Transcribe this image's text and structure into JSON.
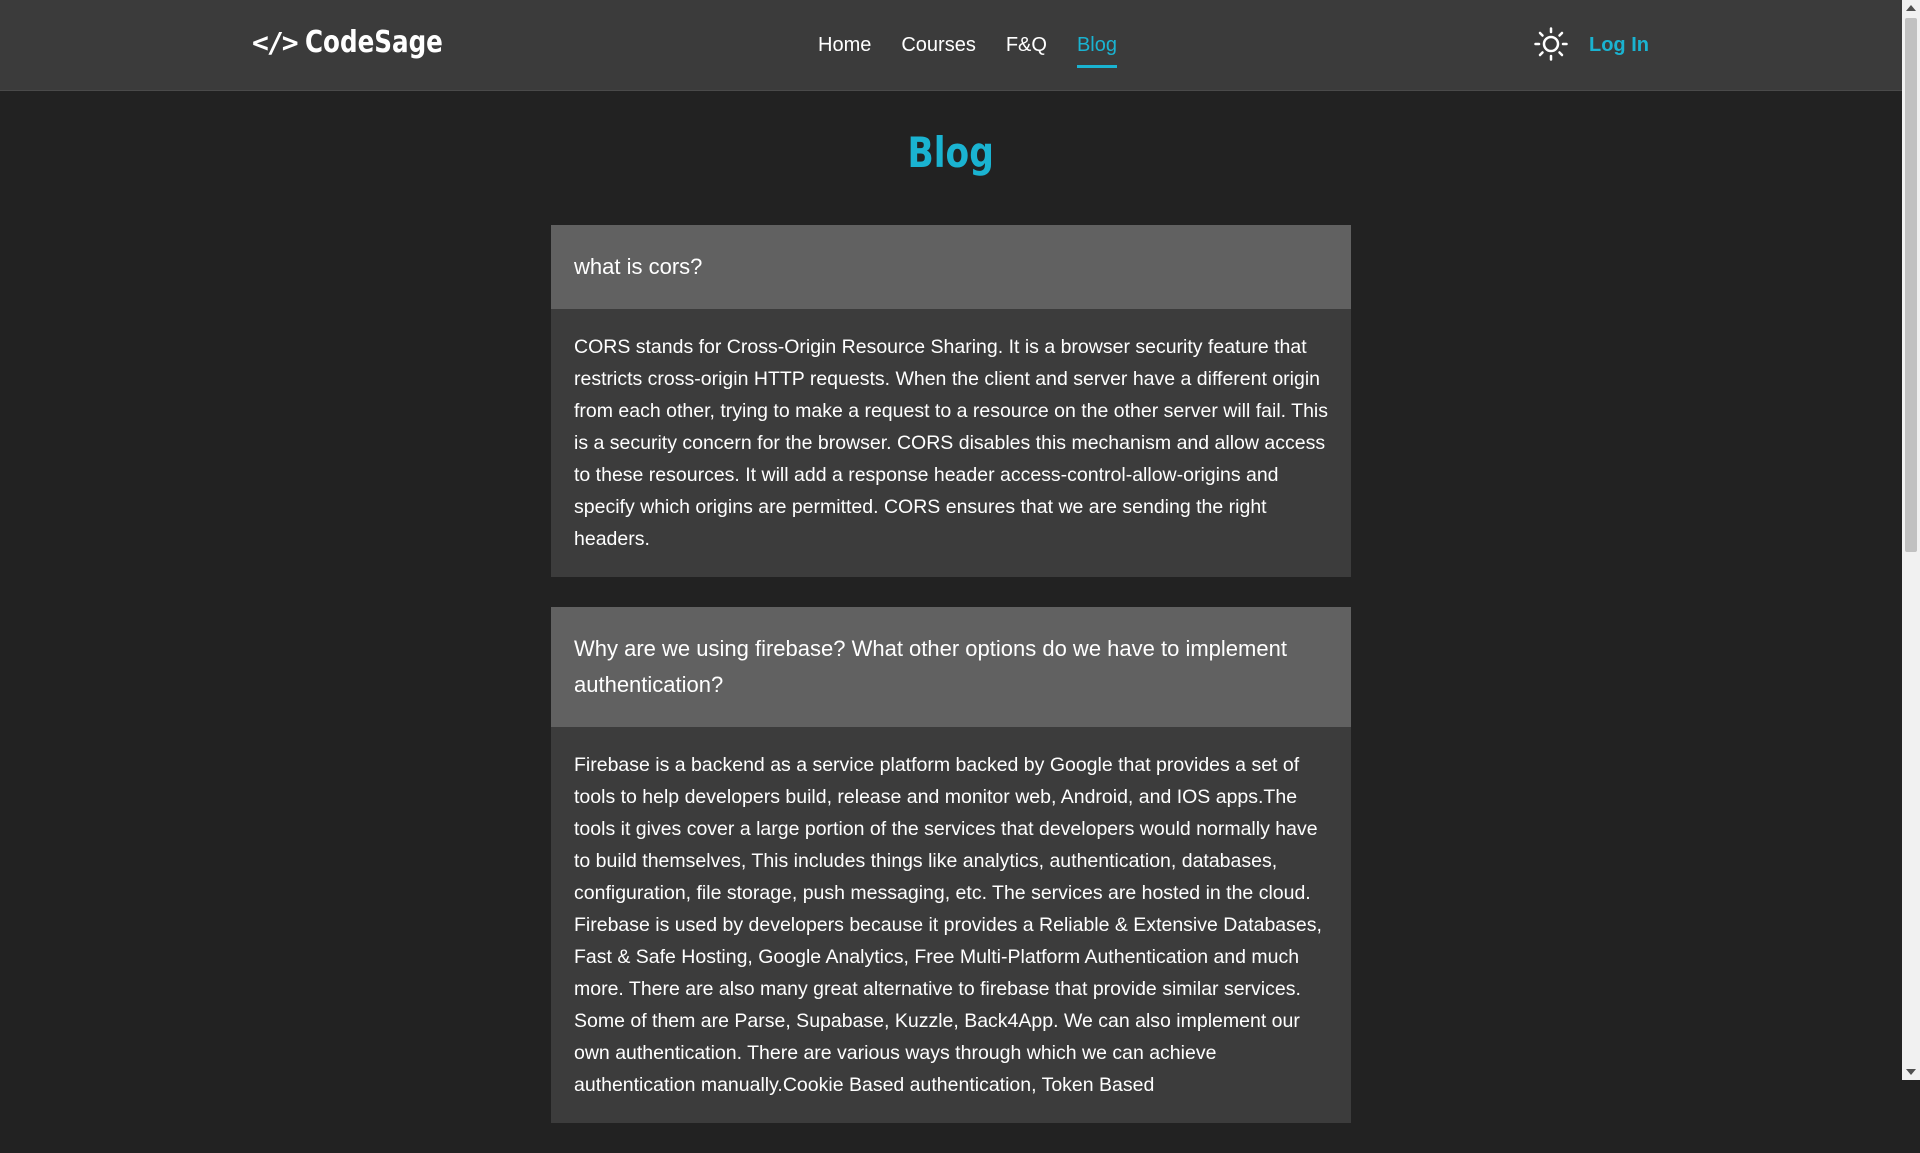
{
  "header": {
    "logo_icon": "</>",
    "logo_text": "CodeSage",
    "nav": [
      {
        "label": "Home"
      },
      {
        "label": "Courses"
      },
      {
        "label": "F&Q"
      },
      {
        "label": "Blog"
      }
    ],
    "active_nav": "Blog",
    "theme_icon": "sun-icon",
    "login_label": "Log In",
    "accent_color": "#1ab3d1"
  },
  "main": {
    "title": "Blog",
    "posts": [
      {
        "question": "what is cors?",
        "answer": "CORS stands for Cross-Origin Resource Sharing. It is a browser security feature that restricts cross-origin HTTP requests. When the client and server have a different origin from each other, trying to make a request to a resource on the other server will fail. This is a security concern for the browser. CORS disables this mechanism and allow access to these resources. It will add a response header access-control-allow-origins and specify which origins are permitted. CORS ensures that we are sending the right headers."
      },
      {
        "question": "Why are we using firebase? What other options do we have to implement authentication?",
        "answer": "Firebase is a backend as a service platform backed by Google that provides a set of tools to help developers build, release and monitor web, Android, and IOS apps.The tools it gives cover a large portion of the services that developers would normally have to build themselves, This includes things like analytics, authentication, databases, configuration, file storage, push messaging, etc. The services are hosted in the cloud. Firebase is used by developers because it provides a Reliable & Extensive Databases, Fast & Safe Hosting, Google Analytics, Free Multi-Platform Authentication and much more. There are also many great alternative to firebase that provide similar services. Some of them are Parse, Supabase, Kuzzle, Back4App. We can also implement our own authentication. There are various ways through which we can achieve authentication manually.Cookie Based authentication, Token Based"
      }
    ]
  }
}
